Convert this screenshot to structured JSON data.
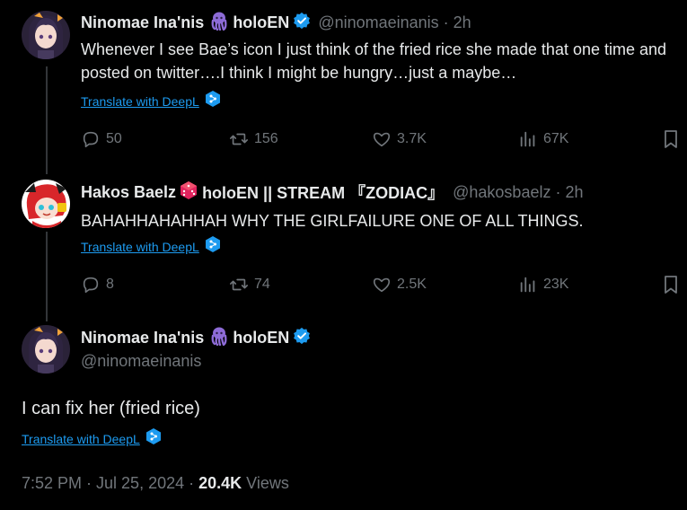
{
  "tweet1": {
    "display_name": "Ninomae Ina'nis",
    "name_suffix": "holoEN",
    "handle_time": "@ninomaeinanis · 2h",
    "text": "Whenever I see Bae’s icon I just think of the fried rice she made that one time and posted on twitter….I think I might be hungry…just a maybe…",
    "translate": "Translate with DeepL",
    "replies": "50",
    "reposts": "156",
    "likes": "3.7K",
    "views": "67K"
  },
  "tweet2": {
    "display_name": "Hakos Baelz",
    "name_suffix": "holoEN || STREAM 『ZODIAC』",
    "handle_time": "@hakosbaelz · 2h",
    "text": "BAHAHHAHAHHAH WHY THE GIRLFAILURE ONE OF ALL THINGS.",
    "translate": "Translate with DeepL",
    "replies": "8",
    "reposts": "74",
    "likes": "2.5K",
    "views": "23K"
  },
  "main": {
    "display_name": "Ninomae Ina'nis",
    "name_suffix": "holoEN",
    "handle": "@ninomaeinanis",
    "text": "I can fix her (fried rice)",
    "translate": "Translate with DeepL",
    "timestamp": "7:52 PM · Jul 25, 2024 · ",
    "view_count": "20.4K",
    "views_label": "Views"
  },
  "colors": {
    "background": "#000000",
    "accent": "#1d9bf0",
    "muted": "#71767b",
    "text": "#e7e9ea",
    "octopus": "#8d6bd6"
  },
  "icons": [
    "octopus-emoji",
    "verified-badge-icon",
    "dice-emoji",
    "deepl-icon",
    "reply-icon",
    "repost-icon",
    "like-icon",
    "views-icon",
    "bookmark-icon"
  ]
}
